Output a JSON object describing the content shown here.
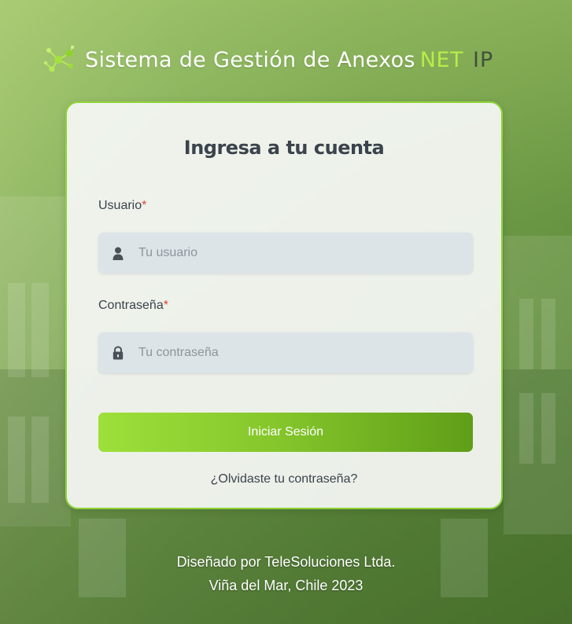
{
  "brand": {
    "name": "Sistema de Gestión de Anexos",
    "net": "NET",
    "ip": "IP"
  },
  "login": {
    "title": "Ingresa a tu cuenta",
    "username": {
      "label": "Usuario",
      "required_mark": "*",
      "placeholder": "Tu usuario",
      "value": "",
      "icon": "user-icon"
    },
    "password": {
      "label": "Contraseña",
      "required_mark": "*",
      "placeholder": "Tu contraseña",
      "value": "",
      "icon": "lock-icon"
    },
    "submit_label": "Iniciar Sesión",
    "forgot_label": "¿Olvidaste tu contraseña?"
  },
  "footer": {
    "line1": "Diseñado por TeleSoluciones Ltda.",
    "line2": "Viña del Mar, Chile 2023"
  },
  "colors": {
    "accent": "#8fd33a",
    "net_text": "#b6ec4a",
    "required": "#e0463a",
    "button_start": "#9de03a",
    "button_end": "#5f9e18"
  }
}
